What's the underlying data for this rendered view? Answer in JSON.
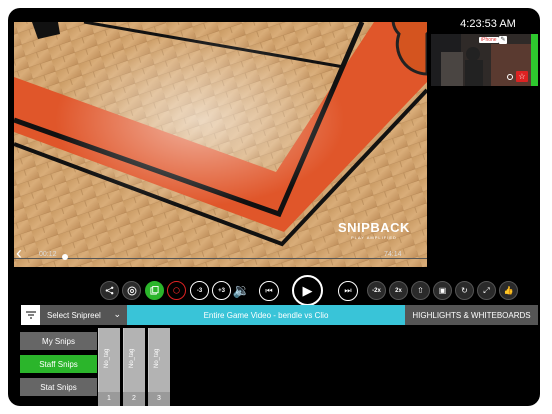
{
  "status_bar": {
    "time": "4:23:53 AM"
  },
  "player": {
    "elapsed": "00:12",
    "duration": "74:14",
    "progress": 0.0027,
    "watermark": {
      "logo": "SNIPBACK",
      "tagline": "PLAY AMPLIFIED"
    }
  },
  "pip": {
    "label": "iPhone",
    "accent_color": "#2ec82e"
  },
  "controls": {
    "rewind_label": "-3",
    "forward_label": "+3",
    "rate_down_label": "-2x",
    "rate_up_label": "2x",
    "accent_color": "#2bb52b",
    "record_color": "#dd2222"
  },
  "tabs": {
    "select_snipreel": "Select Snipreel",
    "game_video": "Entire Game Video - bendle vs Clio",
    "highlights": "HIGHLIGHTS & WHITEBOARDS",
    "active_color": "#39c4d8"
  },
  "snip_menu": {
    "items": [
      {
        "label": "My Snips",
        "active": false
      },
      {
        "label": "Staff Snips",
        "active": true
      },
      {
        "label": "Stat Snips",
        "active": false
      }
    ]
  },
  "clips": [
    {
      "tag": "No_tag",
      "number": "1"
    },
    {
      "tag": "No_tag",
      "number": "2"
    },
    {
      "tag": "No_tag",
      "number": "3"
    }
  ]
}
